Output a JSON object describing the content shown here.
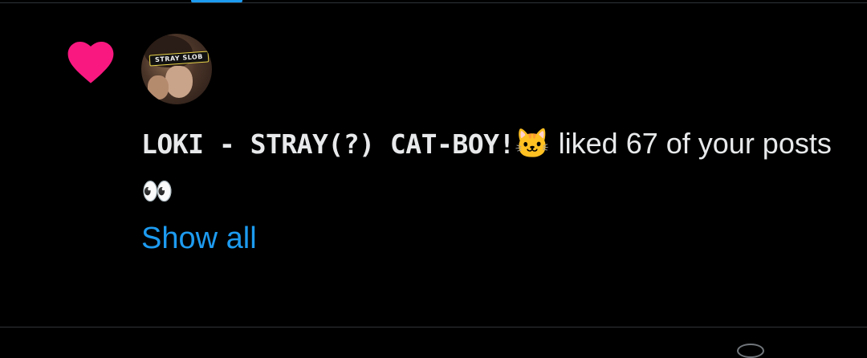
{
  "notification": {
    "type_icon": "heart-icon",
    "display_name": "LOKI - STRAY(?) CAT-BOY!",
    "name_emoji": "🐱",
    "action_text": " liked 67 of your posts",
    "comment_emoji": "👀",
    "show_all_label": "Show all",
    "avatar": {
      "banner_text": "STRAY SLOB"
    }
  },
  "colors": {
    "background": "#000000",
    "text": "#e7e9ea",
    "link": "#1d9bf0",
    "like": "#f91880",
    "divider": "#2f3336"
  }
}
